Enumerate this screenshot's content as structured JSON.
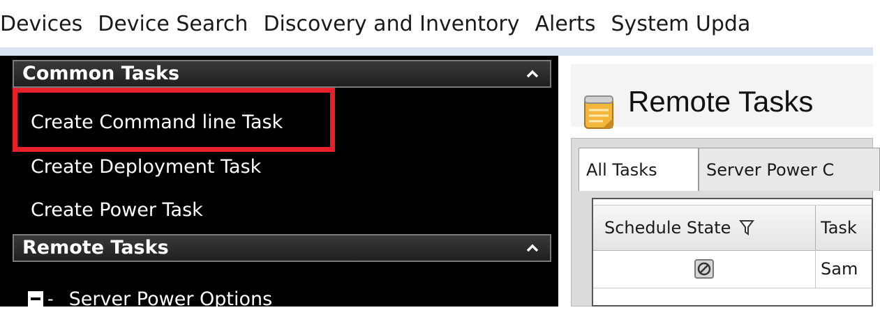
{
  "menubar": {
    "items": [
      "Devices",
      "Device Search",
      "Discovery and Inventory",
      "Alerts",
      "System Upda"
    ]
  },
  "sidebar": {
    "common_tasks": {
      "title": "Common Tasks",
      "items": [
        "Create Command line Task",
        "Create Deployment Task",
        "Create Power Task"
      ]
    },
    "remote_tasks": {
      "title": "Remote Tasks",
      "tree_items": [
        "Server Power Options"
      ]
    }
  },
  "main": {
    "page_title": "Remote Tasks",
    "tabs": [
      "All Tasks",
      "Server Power C"
    ],
    "grid": {
      "columns": [
        "Schedule State",
        "Task"
      ],
      "rows": [
        [
          "",
          "Sam"
        ]
      ]
    }
  },
  "colors": {
    "highlight": "#e8202a",
    "panel_bg": "#000000",
    "menubar_underline": "#d9e2f0"
  },
  "icons": {
    "section_collapse": "chevron-up-icon",
    "filter": "filter-icon",
    "schedule_state": "schedule-disabled-icon",
    "page_icon": "tasks-notepad-icon"
  }
}
